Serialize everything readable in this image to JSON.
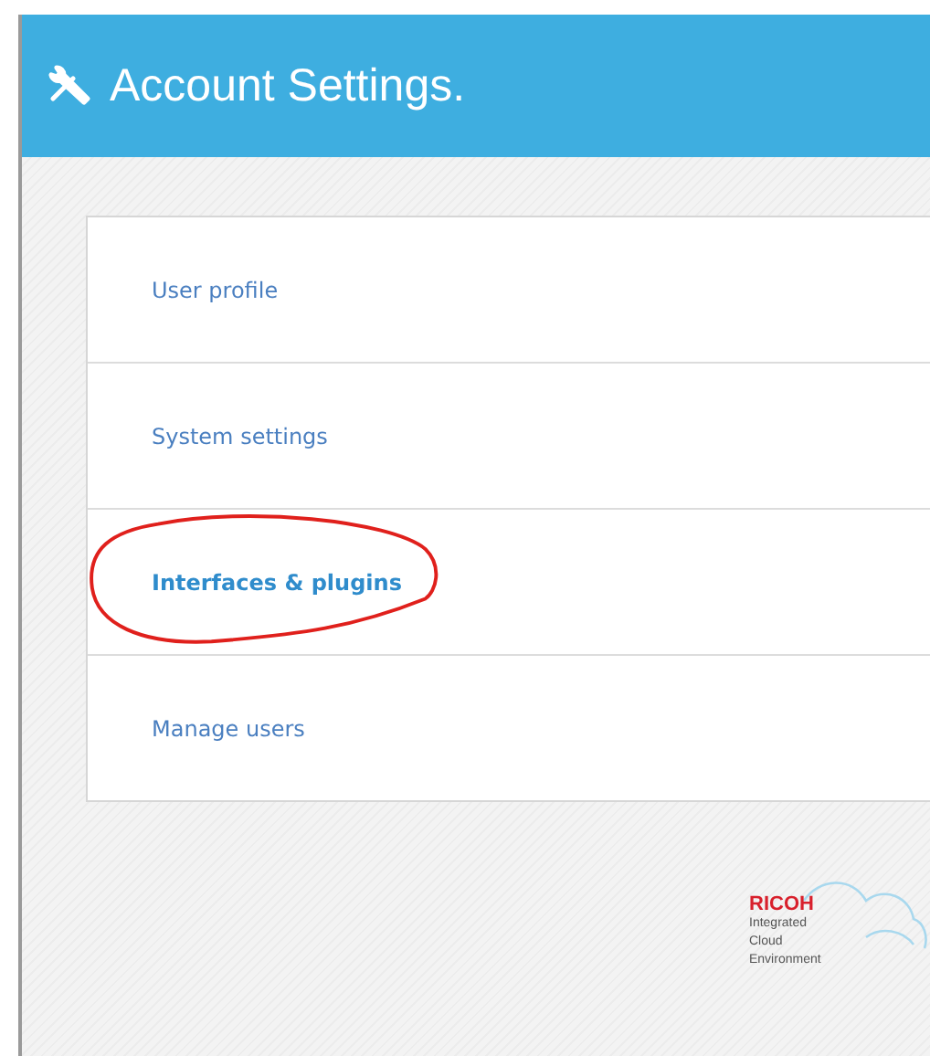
{
  "header": {
    "title": "Account Settings."
  },
  "menu": {
    "items": [
      {
        "label": "User profile",
        "selected": false,
        "circled": false
      },
      {
        "label": "System settings",
        "selected": false,
        "circled": false
      },
      {
        "label": "Interfaces & plugins",
        "selected": true,
        "circled": true
      },
      {
        "label": "Manage users",
        "selected": false,
        "circled": false
      }
    ]
  },
  "logo": {
    "brand": "RICOH",
    "lines": [
      "Integrated",
      "Cloud",
      "Environment"
    ]
  }
}
